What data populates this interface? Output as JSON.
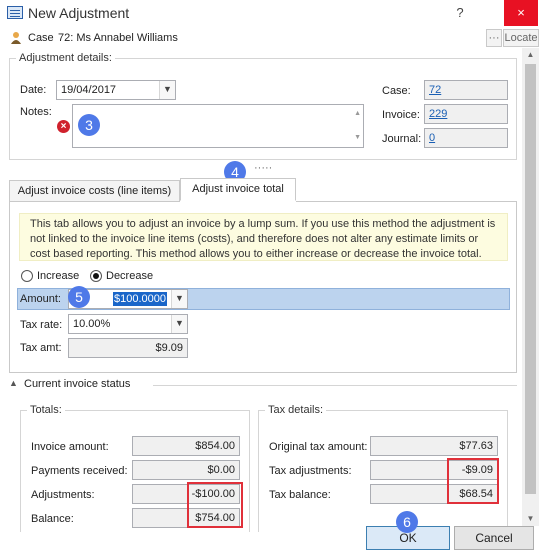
{
  "window": {
    "title": "New Adjustment",
    "help_label": "?",
    "close_label": "×"
  },
  "case_bar": {
    "label": "Case",
    "case_text": "72: Ms Annabel Williams",
    "more_label": "···",
    "locate_label": "Locate"
  },
  "adjustment_details": {
    "legend": "Adjustment details:",
    "date_label": "Date:",
    "date_value": "19/04/2017",
    "notes_label": "Notes:",
    "notes_value": "",
    "case_label": "Case:",
    "case_value": "72",
    "invoice_label": "Invoice:",
    "invoice_value": "229",
    "journal_label": "Journal:",
    "journal_value": "0"
  },
  "splitter": {
    "label": "·····"
  },
  "tabs": [
    {
      "label": "Adjust invoice costs (line items)",
      "active": false
    },
    {
      "label": "Adjust invoice total",
      "active": true
    }
  ],
  "invoice_total": {
    "info": "This tab allows you to adjust an invoice by a lump sum. If you use this method the adjustment is not linked to the invoice line items (costs), and therefore does not alter any estimate limits or cost based reporting. This method allows you to either increase or decrease the invoice total.",
    "increase_label": "Increase",
    "decrease_label": "Decrease",
    "selected": "Decrease",
    "amount_label": "Amount:",
    "amount_value": "$100.0000",
    "tax_rate_label": "Tax rate:",
    "tax_rate_value": "10.00%",
    "tax_amt_label": "Tax amt:",
    "tax_amt_value": "$9.09"
  },
  "status": {
    "header": "Current invoice status",
    "totals": {
      "legend": "Totals:",
      "rows": [
        {
          "label": "Invoice amount:",
          "value": "$854.00"
        },
        {
          "label": "Payments received:",
          "value": "$0.00"
        },
        {
          "label": "Adjustments:",
          "value": "-$100.00"
        },
        {
          "label": "Balance:",
          "value": "$754.00"
        }
      ]
    },
    "tax": {
      "legend": "Tax details:",
      "rows": [
        {
          "label": "Original tax amount:",
          "value": "$77.63"
        },
        {
          "label": "Tax adjustments:",
          "value": "-$9.09"
        },
        {
          "label": "Tax balance:",
          "value": "$68.54"
        }
      ]
    }
  },
  "buttons": {
    "ok_label": "OK",
    "cancel_label": "Cancel"
  },
  "callouts": {
    "notes": "3",
    "tab": "4",
    "amount": "5",
    "ok": "6"
  },
  "colors": {
    "callout": "#4f79e8",
    "highlight": "#e0303a",
    "selection": "#bcd3ee"
  }
}
